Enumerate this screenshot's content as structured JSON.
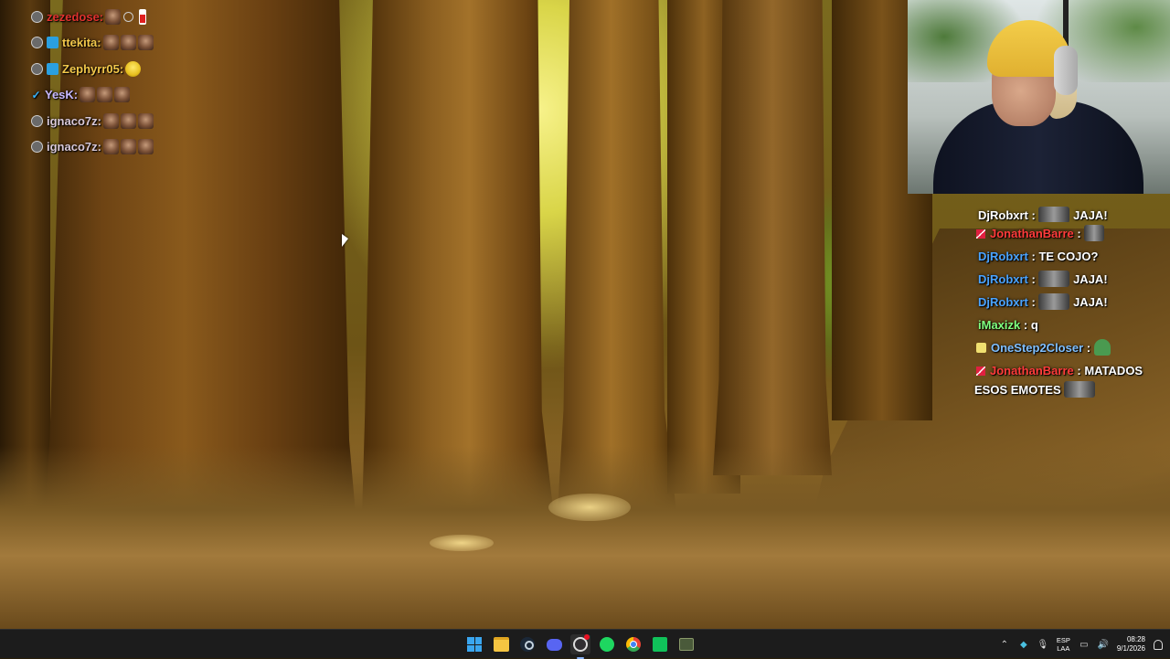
{
  "top_left_chat": [
    {
      "username": "zezedose:",
      "color": "#e0322e",
      "icon": "moderator-badge-icon"
    },
    {
      "username": "ttekita:",
      "color": "#f2c84b",
      "icon": "subscriber-badge-icon"
    },
    {
      "username": "Zephyrr05:",
      "color": "#f2c84b",
      "icon": "subscriber-badge-icon"
    },
    {
      "username": "YesK:",
      "color": "#c7b8ff",
      "icon": "verified-check-icon"
    },
    {
      "username": "ignaco7z:",
      "color": "#d8c8d8",
      "icon": "moderator-badge-icon"
    },
    {
      "username": "ignaco7z:",
      "color": "#d8c8d8",
      "icon": "moderator-badge-icon"
    }
  ],
  "chat": {
    "messages": [
      {
        "user": "DjRobxrt",
        "user_color": "#4aa3ff",
        "sep": " : ",
        "text": "JAJA!",
        "badge": ""
      },
      {
        "user": "JonathanBarre",
        "user_color": "#ff3b3b",
        "sep": " : ",
        "text": "",
        "badge": "prime"
      },
      {
        "user": "DjRobxrt",
        "user_color": "#4aa3ff",
        "sep": " : ",
        "text": "TE COJO?",
        "badge": ""
      },
      {
        "user": "DjRobxrt",
        "user_color": "#4aa3ff",
        "sep": " : ",
        "text": "JAJA!",
        "badge": ""
      },
      {
        "user": "DjRobxrt",
        "user_color": "#4aa3ff",
        "sep": " : ",
        "text": "JAJA!",
        "badge": ""
      },
      {
        "user": "iMaxizk",
        "user_color": "#7fff7f",
        "sep": " : ",
        "text": "q",
        "badge": ""
      },
      {
        "user": "OneStep2Closer",
        "user_color": "#7fbfff",
        "sep": " : ",
        "text": "",
        "badge": "clip"
      },
      {
        "user": "JonathanBarre",
        "user_color": "#ff3b3b",
        "sep": " : ",
        "text": "MATADOS ESOS EMOTES",
        "badge": "prime"
      }
    ]
  },
  "taskbar": {
    "apps": [
      "start-icon",
      "file-explorer-icon",
      "steam-icon",
      "discord-icon",
      "obs-icon",
      "spotify-icon",
      "chrome-icon",
      "camtasia-icon",
      "minecraft-icon"
    ],
    "tray": {
      "lang_top": "ESP",
      "lang_bottom": "LAA",
      "time": "08:28",
      "date": "9/1/2026"
    }
  },
  "colors": {
    "taskbar_bg": "#1c1c1c",
    "windows_accent": "#3aa6f0"
  }
}
